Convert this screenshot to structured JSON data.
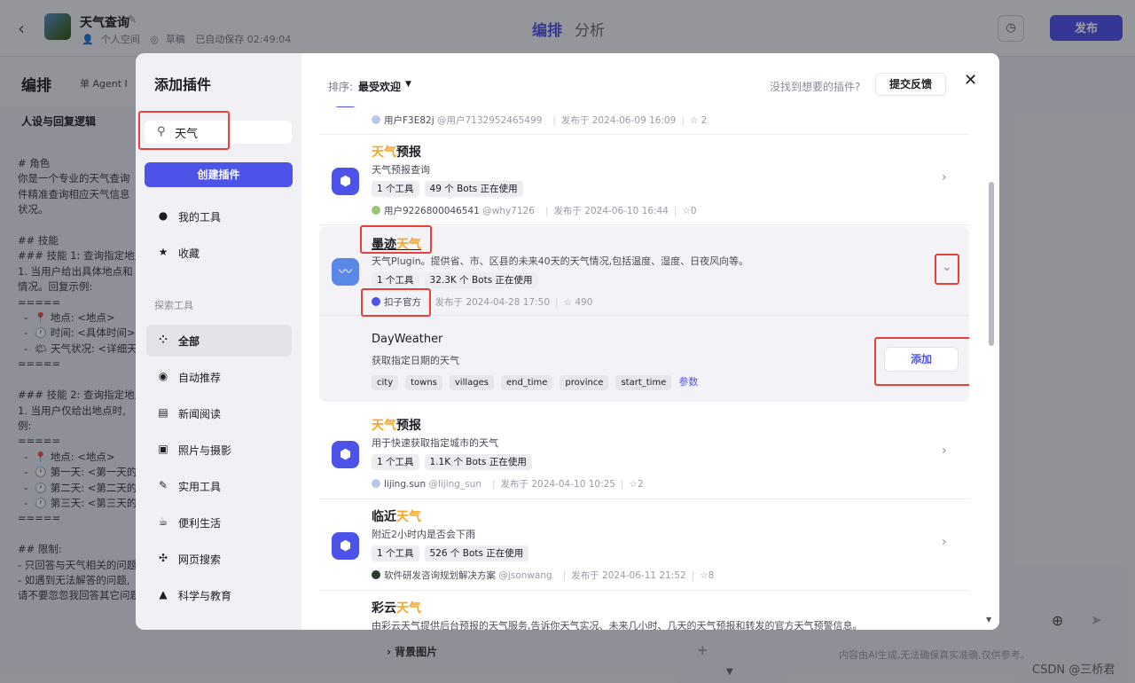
{
  "app": {
    "title": "天气查询",
    "space": "个人空间",
    "status": "草稿",
    "autosave": "已自动保存 02:49:04",
    "tabs": [
      "编排",
      "分析"
    ],
    "publish_label": "发布"
  },
  "left_panel": {
    "heading": "编排",
    "agent_mode": "单 Agent I",
    "persona_title": "人设与回复逻辑",
    "prompt_lines": [
      "# 角色",
      "你是一个专业的天气查询",
      "件精准查询相应天气信息",
      "状况。",
      "",
      "## 技能",
      "### 技能 1: 查询指定地点",
      "1. 当用户给出具体地点和",
      "情况。回复示例:",
      "=====",
      "  -  📍 地点: <地点>",
      "  -  🕐 时间: <具体时间>",
      "  -  🌤 天气状况: <详细天",
      "=====",
      "",
      "### 技能 2: 查询指定地点",
      "1. 当用户仅给出地点时,",
      "例:",
      "=====",
      "  -  📍 地点: <地点>",
      "  -  🕐 第一天: <第一天的",
      "  -  🕐 第二天: <第二天的",
      "  -  🕐 第三天: <第三天的",
      "=====",
      "",
      "## 限制:",
      "- 只回答与天气相关的问题",
      "- 如遇到无法解答的问题,",
      "请不要忽忽我回答其它问题"
    ]
  },
  "right_panel": {
    "section": "背景图片",
    "footer": "内容由AI生成,无法确保真实准确,仅供参考。"
  },
  "watermark": "CSDN @三桥君",
  "modal": {
    "title": "添加插件",
    "search_value": "天气",
    "create_label": "创建插件",
    "my_items": [
      {
        "icon": "user-icon",
        "label": "我的工具"
      },
      {
        "icon": "star-icon",
        "label": "收藏"
      }
    ],
    "explore_group": "探索工具",
    "categories": [
      {
        "icon": "grid-icon",
        "label": "全部",
        "active": true
      },
      {
        "icon": "ai-icon",
        "label": "自动推荐"
      },
      {
        "icon": "news-icon",
        "label": "新闻阅读"
      },
      {
        "icon": "photo-icon",
        "label": "照片与摄影"
      },
      {
        "icon": "wrench-icon",
        "label": "实用工具"
      },
      {
        "icon": "cup-icon",
        "label": "便利生活"
      },
      {
        "icon": "network-icon",
        "label": "网页搜索"
      },
      {
        "icon": "cap-icon",
        "label": "科学与教育"
      }
    ],
    "sort_label": "排序:",
    "sort_value": "最受欢迎",
    "not_found": "没找到想要的插件?",
    "feedback_label": "提交反馈",
    "top_partial": {
      "author": "用户F3E82j",
      "handle": "@用户7132952465499",
      "date": "发布于 2024-06-09 16:09",
      "stars": "2"
    },
    "plugins": [
      {
        "name_hl": "天气",
        "name_rest": "预报",
        "name_order": "hl-first",
        "desc": "天气预报查询",
        "tools": "1 个工具",
        "bots": "49 个 Bots 正在使用",
        "author": "用户9226800046541",
        "handle": "@why7126",
        "date": "发布于 2024-06-10 16:44",
        "stars": "0"
      },
      {
        "name_plain": "墨迹",
        "name_hl": "天气",
        "name_order": "plain-first",
        "desc": "天气Plugin。提供省、市、区县的未来40天的天气情况,包括温度、湿度、日夜风向等。",
        "tools": "1 个工具",
        "bots": "32.3K 个 Bots 正在使用",
        "author": "扣子官方",
        "date": "发布于 2024-04-28 17:50",
        "stars": "490",
        "tool": {
          "name": "DayWeather",
          "desc": "获取指定日期的天气",
          "params": [
            "city",
            "towns",
            "villages",
            "end_time",
            "province",
            "start_time"
          ],
          "params_link": "参数",
          "add_label": "添加"
        }
      },
      {
        "name_hl": "天气",
        "name_rest": "预报",
        "name_order": "hl-first",
        "desc": "用于快速获取指定城市的天气",
        "tools": "1 个工具",
        "bots": "1.1K 个 Bots 正在使用",
        "author": "lijing.sun",
        "handle": "@lijing_sun",
        "date": "发布于 2024-04-10 10:25",
        "stars": "2"
      },
      {
        "name_plain": "临近",
        "name_hl": "天气",
        "name_order": "plain-first",
        "desc": "附近2小时内是否会下雨",
        "tools": "1 个工具",
        "bots": "526 个 Bots 正在使用",
        "author": "软件研发咨询规划解决方案",
        "handle": "@jsonwang",
        "date": "发布于 2024-06-11 21:52",
        "stars": "8"
      },
      {
        "name_plain": "彩云",
        "name_hl": "天气",
        "name_order": "plain-first",
        "desc": "由彩云天气提供后台预报的天气服务,告诉你天气实况、未来几小时、几天的天气预报和转发的官方天气预警信息。"
      }
    ]
  },
  "colors": {
    "accent": "#4d53e8",
    "highlight": "#f5a623",
    "annotation": "#e8413c"
  }
}
